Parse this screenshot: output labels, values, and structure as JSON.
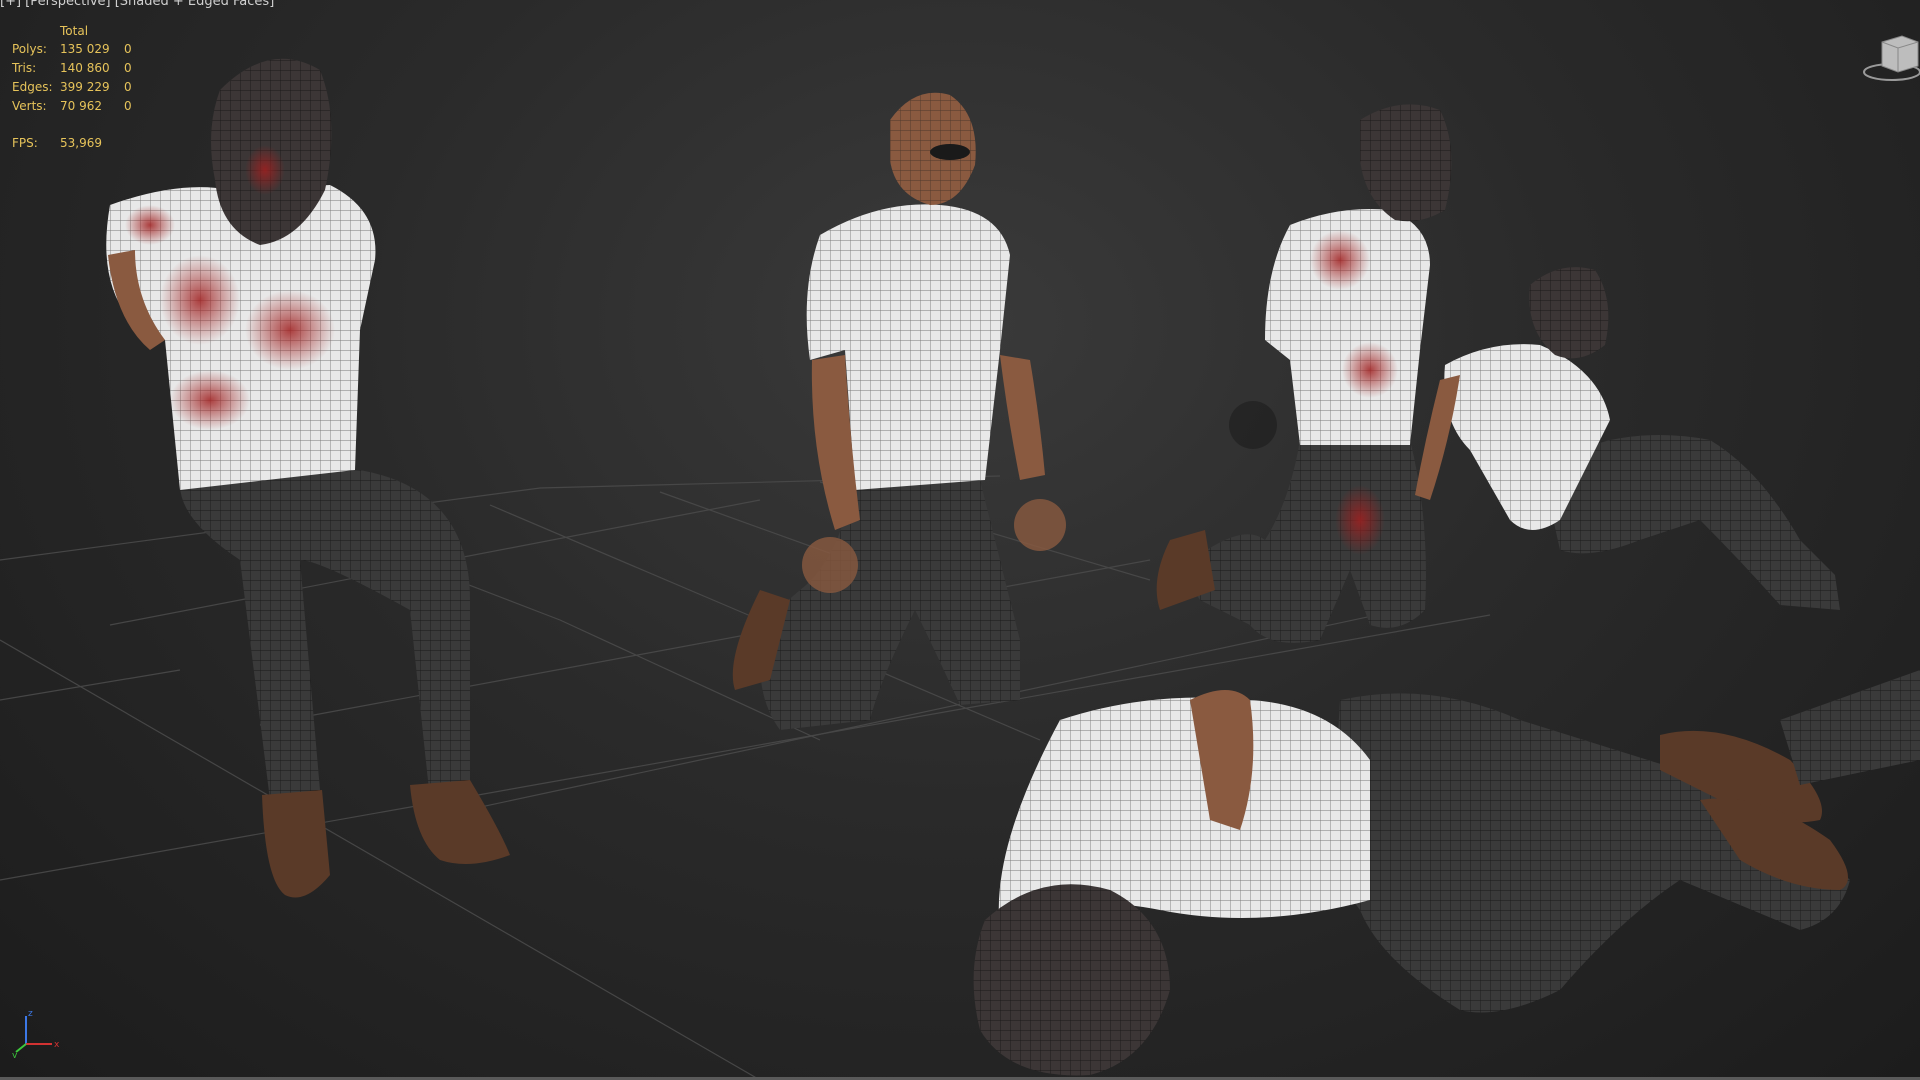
{
  "viewport": {
    "label": "[+] [Perspective] [Shaded + Edged Faces]"
  },
  "stats": {
    "header": "Total",
    "rows": [
      {
        "key": "Polys:",
        "value": "135 029",
        "selected": "0"
      },
      {
        "key": "Tris:",
        "value": "140 860",
        "selected": "0"
      },
      {
        "key": "Edges:",
        "value": "399 229",
        "selected": "0"
      },
      {
        "key": "Verts:",
        "value": "70 962",
        "selected": "0"
      }
    ],
    "fps_label": "FPS:",
    "fps_value": "53,969"
  },
  "axis": {
    "x": "x",
    "y": "y",
    "z": "z"
  },
  "colors": {
    "stats_text": "#e6c35a",
    "grid": "#4a4a4a",
    "axis_x": "#d23232",
    "axis_y": "#3cc83c",
    "axis_z": "#3c78e6",
    "shirt": "#e8e8e8",
    "shirt_blood": "#a02020",
    "pants": "#3a3a3a",
    "skin": "#8a5a40",
    "boot": "#5a3a28"
  },
  "icons": {
    "viewcube": "viewcube-icon",
    "axis_tripod": "axis-tripod-icon"
  }
}
